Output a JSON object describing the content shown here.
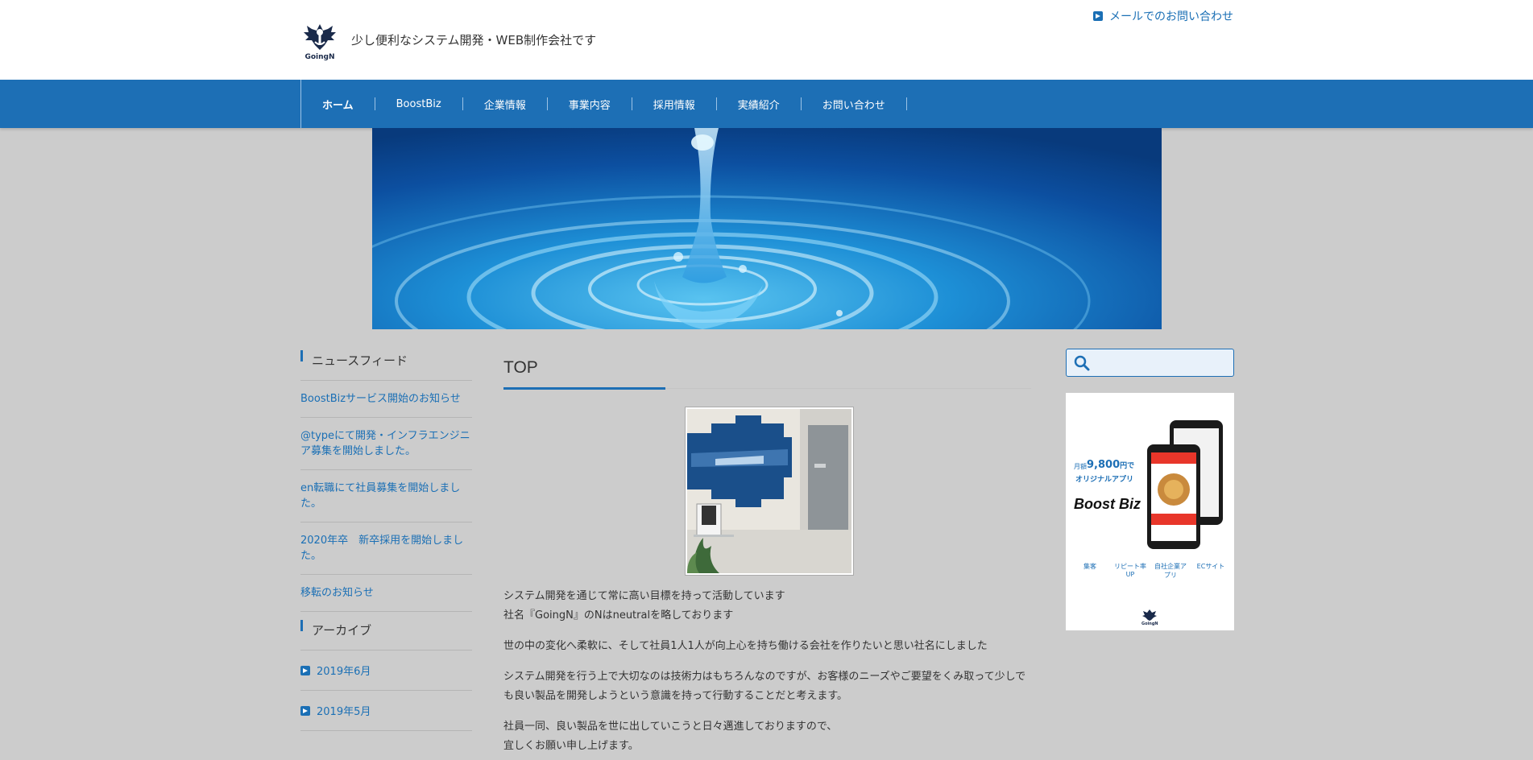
{
  "header": {
    "logo_text": "GoingN",
    "tagline": "少し便利なシステム開発・WEB制作会社です",
    "contact_label": "メールでのお問い合わせ"
  },
  "nav": {
    "items": [
      "ホーム",
      "BoostBiz",
      "企業情報",
      "事業内容",
      "採用情報",
      "実績紹介",
      "お問い合わせ"
    ]
  },
  "sidebar": {
    "news_heading": "ニュースフィード",
    "news": [
      "BoostBizサービス開始のお知らせ",
      "@typeにて開発・インフラエンジニア募集を開始しました。",
      "en転職にて社員募集を開始しました。",
      "2020年卒　新卒採用を開始しました。",
      "移転のお知らせ"
    ],
    "archive_heading": "アーカイブ",
    "archives": [
      "2019年6月",
      "2019年5月"
    ]
  },
  "main": {
    "title": "TOP",
    "paragraphs": [
      "システム開発を通じて常に高い目標を持って活動しています",
      "社名『GoingN』のNはneutralを略しております",
      "世の中の変化へ柔軟に、そして社員1人1人が向上心を持ち働ける会社を作りたいと思い社名にしました",
      "システム開発を行う上で大切なのは技術力はもちろんなのですが、お客様のニーズやご要望をくみ取って少しでも良い製品を開発しようという意識を持って行動することだと考えます。",
      "社員一同、良い製品を世に出していこうと日々邁進しておりますので、",
      "宜しくお願い申し上げます。"
    ]
  },
  "search": {
    "placeholder": ""
  },
  "ad": {
    "price_line1": "月額",
    "price": "9,800",
    "price_unit": "円で",
    "price_line2": "オリジナルアプリ",
    "brand": "Boost Biz",
    "features": [
      "集客",
      "リピート率UP",
      "自社企業アプリ",
      "ECサイト"
    ],
    "logo_text": "GoingN"
  },
  "colors": {
    "accent": "#1d6fb5",
    "background": "#cccccc",
    "link": "#1a6fb5"
  }
}
